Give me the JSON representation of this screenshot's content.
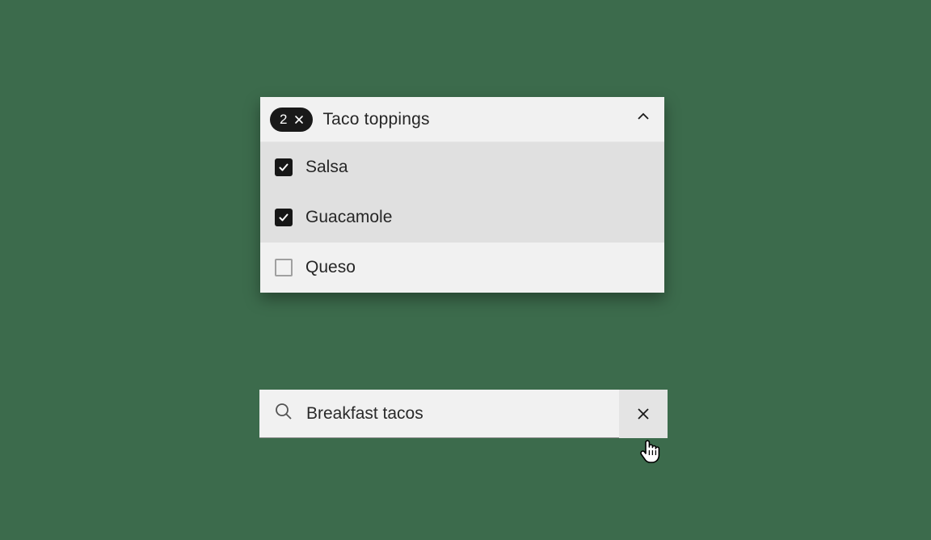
{
  "multiselect": {
    "count": "2",
    "title": "Taco toppings",
    "options": [
      {
        "label": "Salsa",
        "checked": true,
        "highlight": true
      },
      {
        "label": "Guacamole",
        "checked": true,
        "highlight": true
      },
      {
        "label": "Queso",
        "checked": false,
        "highlight": false
      }
    ]
  },
  "search": {
    "value": "Breakfast tacos"
  }
}
